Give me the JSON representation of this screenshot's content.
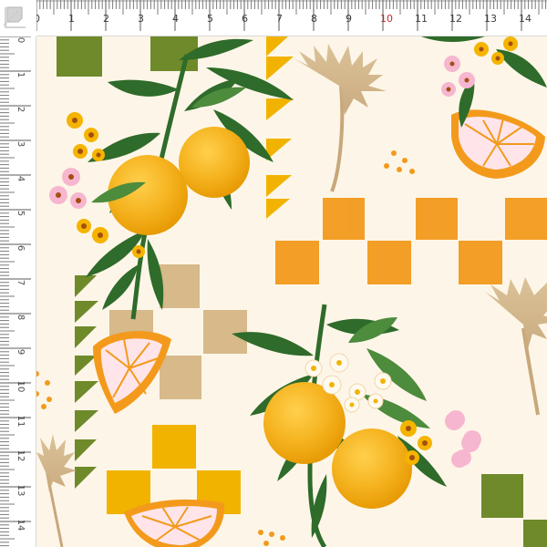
{
  "ruler": {
    "top_labels": [
      "0",
      "1",
      "2",
      "3",
      "4",
      "5",
      "6",
      "7",
      "8",
      "9",
      "10",
      "11",
      "12",
      "13",
      "14"
    ],
    "left_labels": [
      "0",
      "1",
      "2",
      "3",
      "4",
      "5",
      "6",
      "7",
      "8",
      "9",
      "10",
      "11",
      "12",
      "13",
      "14"
    ],
    "highlight_label": "10",
    "highlight_color": "#c62828"
  },
  "palette": {
    "cream": "#fdf6e8",
    "olive": "#6f8a2a",
    "mustard": "#f2b300",
    "orange": "#f39a1c",
    "tan": "#d7b98a",
    "leaf_dark": "#2f6b2a",
    "leaf_light": "#4d8b3d",
    "pink": "#f7b6cf",
    "white_flower": "#fffaf0"
  }
}
